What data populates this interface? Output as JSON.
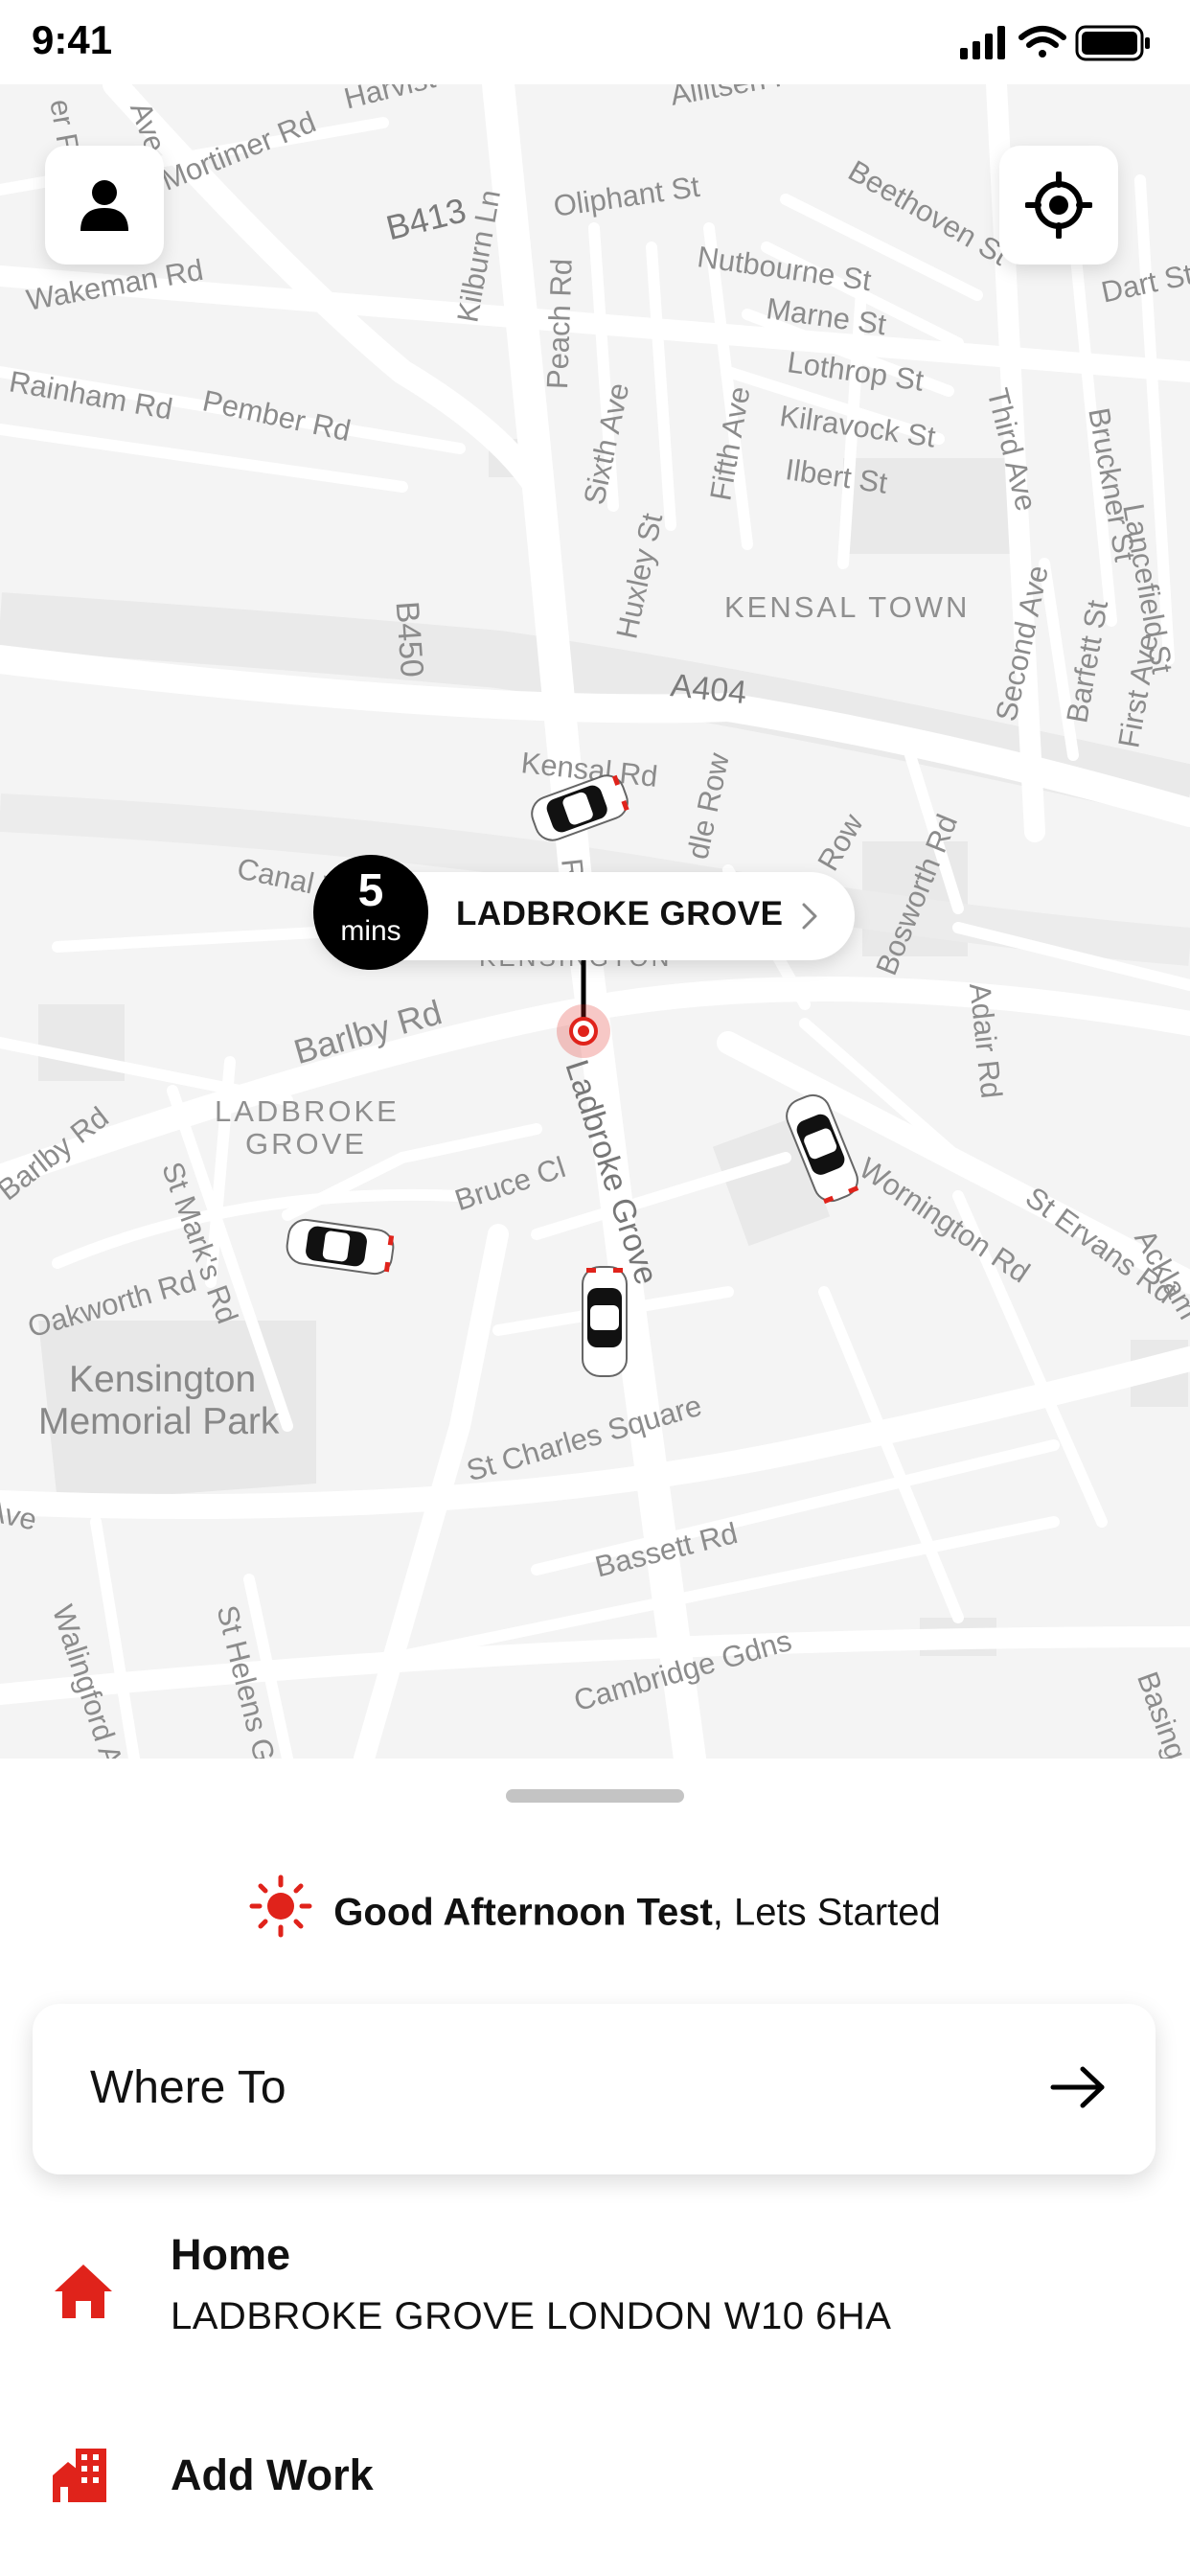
{
  "status_bar": {
    "time": "9:41"
  },
  "map": {
    "street_labels": [
      "Harvist Rd",
      "Allitsen Rd",
      "Ave",
      "er Rd",
      "Mortimer Rd",
      "B413",
      "Oliphant St",
      "Beethoven St",
      "Wakeman Rd",
      "Kilburn Ln",
      "Peach Rd",
      "Nutbourne St",
      "Marne St",
      "Dart St",
      "Rainham Rd",
      "Pember Rd",
      "Sixth Ave",
      "Fifth Ave",
      "Lothrop St",
      "Kilravock St",
      "Third Ave",
      "Bruckner St",
      "Lancefield St",
      "Ilbert St",
      "B450",
      "Huxley St",
      "Second Ave",
      "Barfett St",
      "First Ave",
      "A404",
      "Kensal Rd",
      "Canal Way",
      "Row",
      "dle Row",
      "Row",
      "Bosworth Rd",
      "Adair Rd",
      "Barlby Rd",
      "Barlby Rd",
      "St Mark's Rd",
      "Bruce Cl",
      "Ladbroke Grove",
      "Wornington Rd",
      "St Ervans Rd",
      "Acklam",
      "Oakworth Rd",
      "St Charles Square",
      "Bassett Rd",
      "Walingford Ave",
      "St Helens Gardens",
      "Cambridge Gdns",
      "Ave",
      "Basing",
      "Ladbroke Grove"
    ],
    "area_labels": [
      "KENSAL TOWN",
      "KENSINGTON",
      "LADBROKE",
      "GROVE"
    ],
    "park_label_line1": "Kensington",
    "park_label_line2": "Memorial Park"
  },
  "eta": {
    "minutes": "5",
    "unit": "mins",
    "place": "LADBROKE GROVE"
  },
  "sheet": {
    "greeting_bold": "Good Afternoon Test",
    "greeting_rest": ", Lets Started",
    "where_to": "Where To",
    "home_title": "Home",
    "home_address": "LADBROKE GROVE LONDON W10 6HA",
    "work_title": "Add Work"
  },
  "colors": {
    "accent": "#e0231b",
    "map_bg": "#f4f4f4",
    "road": "#ffffff",
    "block": "#e9e9e9"
  },
  "icons": [
    "cellular-signal-icon",
    "wifi-icon",
    "battery-icon",
    "user-icon",
    "locate-icon",
    "chevron-right-icon",
    "sun-icon",
    "arrow-right-icon",
    "home-icon",
    "building-icon",
    "car-icon",
    "pin-icon"
  ]
}
